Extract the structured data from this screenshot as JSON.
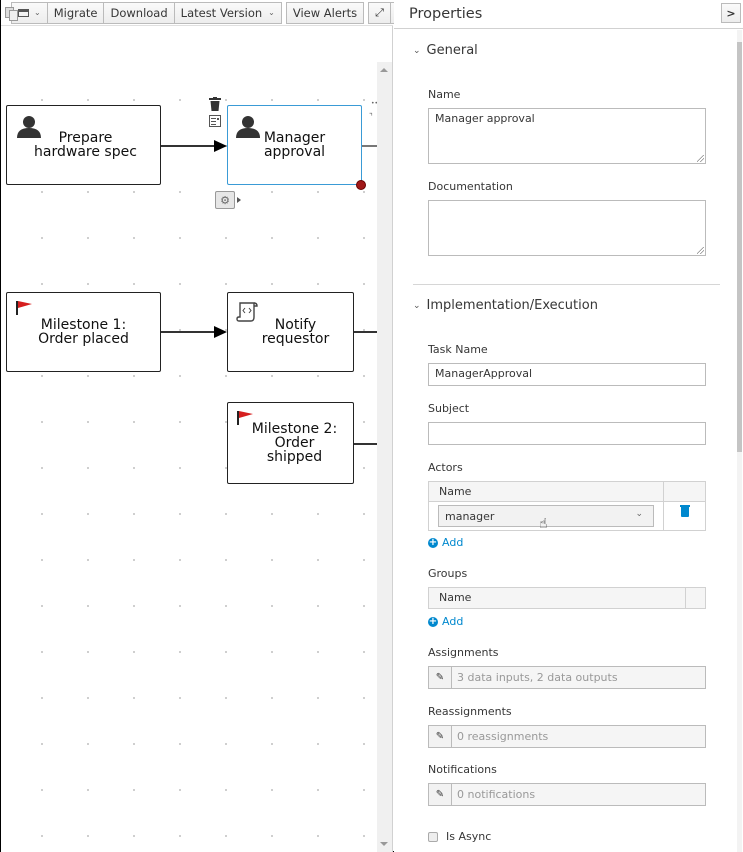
{
  "toolbar": {
    "view_icon": "list-view-icon",
    "buttons": [
      "Migrate",
      "Download",
      "Latest Version",
      "View Alerts"
    ],
    "expand_icon": "expand-icon",
    "close_icon": "close-icon"
  },
  "diagram": {
    "nodes": [
      {
        "label_line1": "Prepare",
        "label_line2": "hardware spec",
        "type": "user-task"
      },
      {
        "label_line1": "Manager",
        "label_line2": "approval",
        "type": "user-task",
        "selected": true
      },
      {
        "label_line1": "Milestone 1:",
        "label_line2": "Order placed",
        "type": "milestone"
      },
      {
        "label_line1": "Notify",
        "label_line2": "requestor",
        "type": "script-task"
      },
      {
        "label_line1": "Milestone 2:",
        "label_line2": "Order",
        "label_line3": "shipped",
        "type": "milestone"
      }
    ]
  },
  "properties": {
    "title": "Properties",
    "collapse_label": ">",
    "general": {
      "title": "General",
      "name_label": "Name",
      "name_value": "Manager approval",
      "documentation_label": "Documentation",
      "documentation_value": ""
    },
    "implementation": {
      "title": "Implementation/Execution",
      "task_name_label": "Task Name",
      "task_name_value": "ManagerApproval",
      "subject_label": "Subject",
      "subject_value": "",
      "actors_label": "Actors",
      "actors_header": "Name",
      "actors_rows": [
        {
          "name": "manager"
        }
      ],
      "add_label": "Add",
      "groups_label": "Groups",
      "groups_header": "Name",
      "assignments_label": "Assignments",
      "assignments_value": "3 data inputs, 2 data outputs",
      "reassignments_label": "Reassignments",
      "reassignments_value": "0 reassignments",
      "notifications_label": "Notifications",
      "notifications_value": "0 notifications",
      "is_async_label": "Is Async",
      "is_async_checked": false
    }
  }
}
